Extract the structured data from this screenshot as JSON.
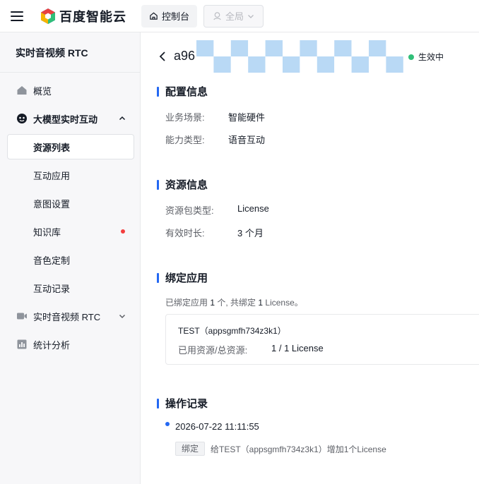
{
  "header": {
    "brand": "百度智能云",
    "console_label": "控制台",
    "region_label": "全局"
  },
  "sidebar": {
    "product_title": "实时音视频 RTC",
    "items": [
      {
        "label": "概览"
      },
      {
        "label": "大模型实时互动"
      },
      {
        "label": "资源列表"
      },
      {
        "label": "互动应用"
      },
      {
        "label": "意图设置"
      },
      {
        "label": "知识库"
      },
      {
        "label": "音色定制"
      },
      {
        "label": "互动记录"
      },
      {
        "label": "实时音视频 RTC"
      },
      {
        "label": "统计分析"
      }
    ]
  },
  "detail": {
    "resource_id_prefix": "a96",
    "status": "生效中",
    "status_color": "#30bf78",
    "accent_color": "#2468f2"
  },
  "config": {
    "title": "配置信息",
    "rows": [
      {
        "label": "业务场景:",
        "value": "智能硬件"
      },
      {
        "label": "能力类型:",
        "value": "语音互动"
      }
    ]
  },
  "resource": {
    "title": "资源信息",
    "rows": [
      {
        "label": "资源包类型:",
        "value": "License"
      },
      {
        "label": "有效时长:",
        "value": "3 个月"
      }
    ]
  },
  "binding": {
    "title": "绑定应用",
    "note_prefix": "已绑定应用 ",
    "apps_count": "1",
    "note_middle": " 个, 共绑定 ",
    "license_count": "1",
    "note_suffix": " License。",
    "app_name": "TEST（appsgmfh734z3k1）",
    "used_label": "已用资源/总资源:",
    "used_value": "1 / 1 License"
  },
  "oplog": {
    "title": "操作记录",
    "time": "2026-07-22 11:11:55",
    "tag": "绑定",
    "text": "给TEST（appsgmfh734z3k1）增加1个License"
  }
}
